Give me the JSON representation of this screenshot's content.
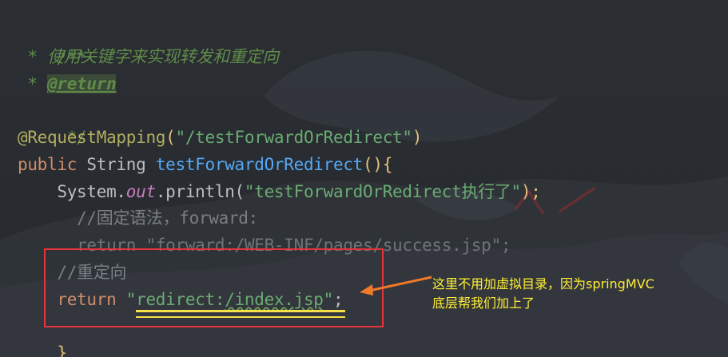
{
  "code": {
    "l1": {
      "t": "/**"
    },
    "l2": {
      "star": " * ",
      "text": "使用关键字来实现转发和重定向"
    },
    "l3": {
      "star": " * ",
      "tag": "@return"
    },
    "l4": {
      "t": " */"
    },
    "l5": {
      "ann": "@RequestMapping",
      "open": "(",
      "str": "\"/testForwardOrRedirect\"",
      "close": ")"
    },
    "l6": {
      "kw": "public",
      "type": " String ",
      "fn": "testForwardOrRedirect",
      "parens": "()",
      "brace": "{"
    },
    "l7": {
      "indent": "    ",
      "obj": "System.",
      "field": "out",
      "call": ".println(",
      "str": "\"testForwardOrRedirect执行了\"",
      "end": ");"
    },
    "l8": {
      "indent": "      ",
      "cmt": "//固定语法，forward:"
    },
    "l9": {
      "indent": "      ",
      "kw": "return",
      "rest": " \"forward:/WEB-INF/pages/success.jsp\";"
    },
    "l10": {
      "indent": "    ",
      "cmt": "//重定向"
    },
    "l11": {
      "indent": "    ",
      "kw": "return",
      "sp": " ",
      "strA": "\"redirect:",
      "strB": "/index.jsp",
      "strC": "\"",
      "end": ";"
    },
    "l12": {
      "t": "}"
    }
  },
  "annotation": {
    "line1": "这里不用加虚拟目录，因为springMVC",
    "line2": "底层帮我们加上了",
    "box_color": "#e8333a",
    "underline_color": "#f5e04a",
    "arrow_color": "#f07a2a",
    "text_color": "#ffee33"
  }
}
